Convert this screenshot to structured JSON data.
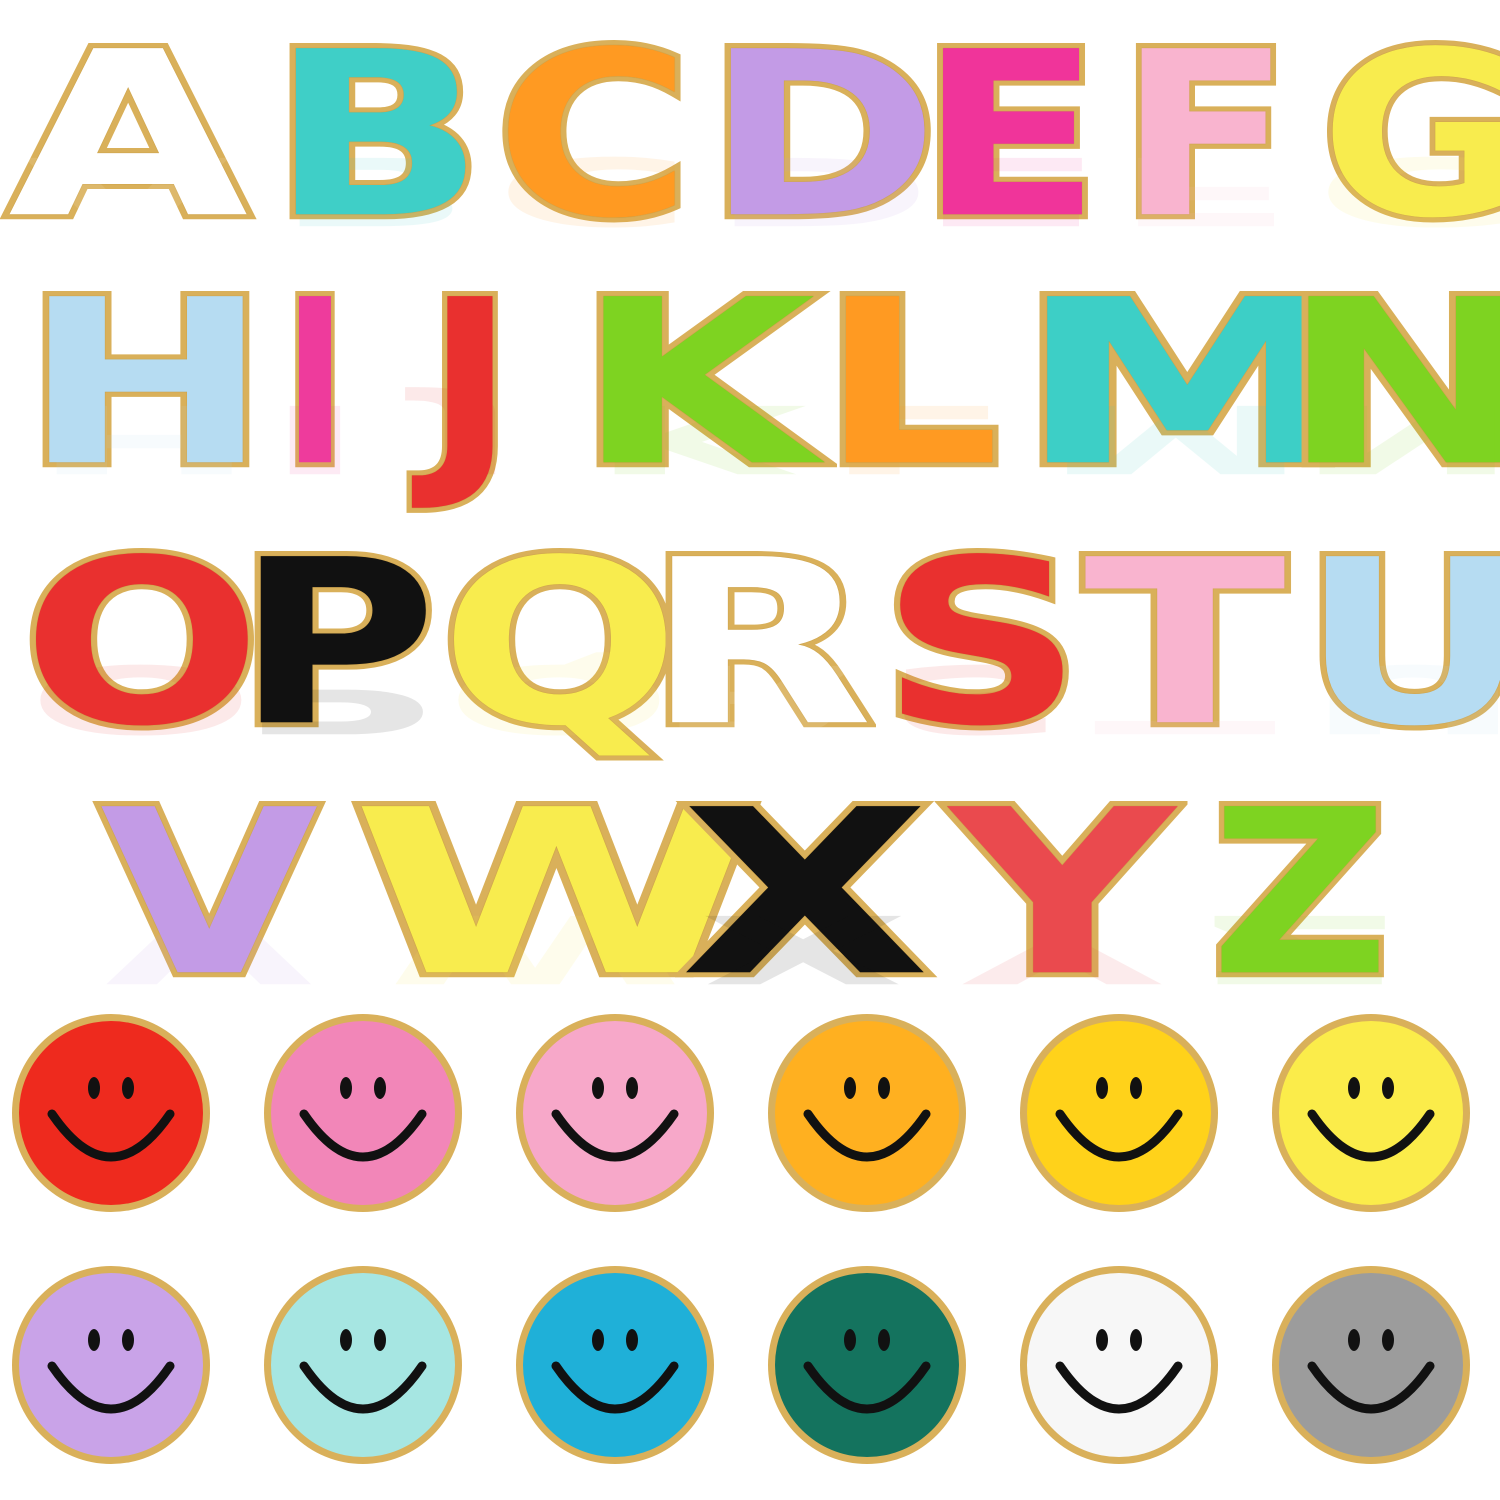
{
  "letters": [
    {
      "char": "A",
      "color": "#ffffff"
    },
    {
      "char": "B",
      "color": "#3fcfc7"
    },
    {
      "char": "C",
      "color": "#ff9a22"
    },
    {
      "char": "D",
      "color": "#c39be6"
    },
    {
      "char": "E",
      "color": "#f0349a"
    },
    {
      "char": "F",
      "color": "#f9b4cf"
    },
    {
      "char": "G",
      "color": "#f8ec4e"
    },
    {
      "char": "H",
      "color": "#b6dcf2"
    },
    {
      "char": "I",
      "color": "#ee3b9c"
    },
    {
      "char": "J",
      "color": "#e9302f"
    },
    {
      "char": "K",
      "color": "#7ed321"
    },
    {
      "char": "L",
      "color": "#ff9a22"
    },
    {
      "char": "M",
      "color": "#3dcfc6"
    },
    {
      "char": "N",
      "color": "#7ed321"
    },
    {
      "char": "O",
      "color": "#e9302f"
    },
    {
      "char": "P",
      "color": "#111111"
    },
    {
      "char": "Q",
      "color": "#f8ec4e"
    },
    {
      "char": "R",
      "color": "#ffffff"
    },
    {
      "char": "S",
      "color": "#e9302f"
    },
    {
      "char": "T",
      "color": "#f9b4cf"
    },
    {
      "char": "U",
      "color": "#b6dcf2"
    },
    {
      "char": "V",
      "color": "#c39be6"
    },
    {
      "char": "W",
      "color": "#f8ec4e"
    },
    {
      "char": "X",
      "color": "#111111"
    },
    {
      "char": "Y",
      "color": "#ea4a4e"
    },
    {
      "char": "Z",
      "color": "#7ed321"
    }
  ],
  "smileys": [
    {
      "color": "#ee2a1e",
      "mouth": "#111111"
    },
    {
      "color": "#f286b8",
      "mouth": "#111111"
    },
    {
      "color": "#f7a8c9",
      "mouth": "#111111"
    },
    {
      "color": "#ffb020",
      "mouth": "#111111"
    },
    {
      "color": "#ffd21a",
      "mouth": "#111111"
    },
    {
      "color": "#fbec4a",
      "mouth": "#111111"
    },
    {
      "color": "#c9a3e8",
      "mouth": "#111111"
    },
    {
      "color": "#a6e6e2",
      "mouth": "#111111"
    },
    {
      "color": "#1fb0d8",
      "mouth": "#111111"
    },
    {
      "color": "#14735e",
      "mouth": "#111111"
    },
    {
      "color": "#f7f7f7",
      "mouth": "#111111"
    },
    {
      "color": "#9c9c9c",
      "mouth": "#111111"
    }
  ]
}
